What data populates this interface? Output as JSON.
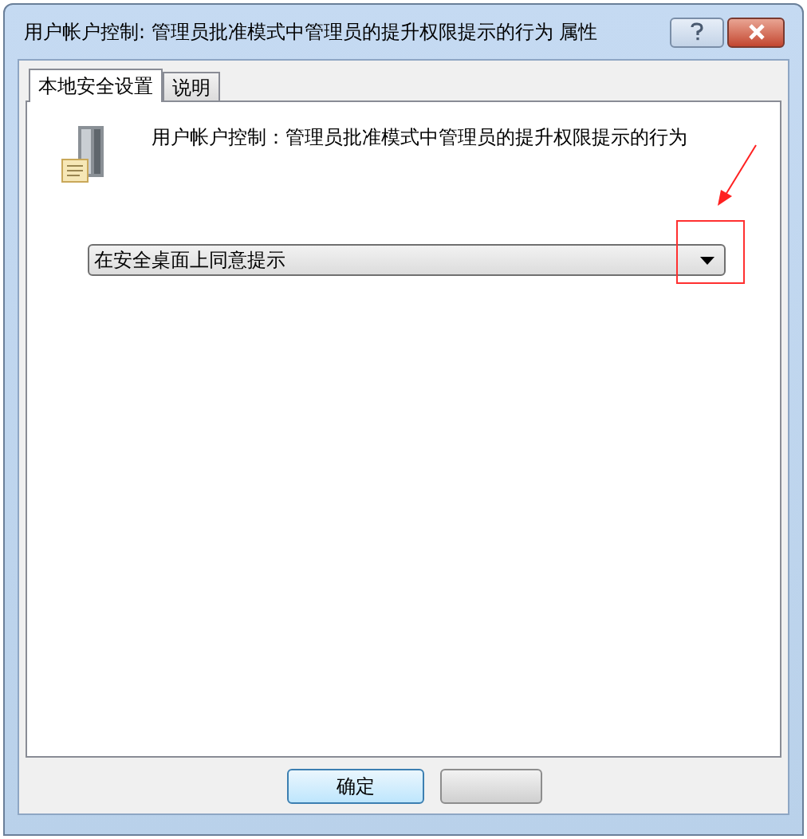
{
  "window": {
    "title": "用户帐户控制: 管理员批准模式中管理员的提升权限提示的行为 属性"
  },
  "tabs": [
    {
      "label": "本地安全设置",
      "selected": true
    },
    {
      "label": "说明",
      "selected": false
    }
  ],
  "policy": {
    "title": "用户帐户控制：管理员批准模式中管理员的提升权限提示的行为"
  },
  "dropdown": {
    "value": "在安全桌面上同意提示"
  },
  "buttons": [
    {
      "kind": "labeled",
      "label": "确定"
    },
    {
      "kind": "blank"
    }
  ]
}
